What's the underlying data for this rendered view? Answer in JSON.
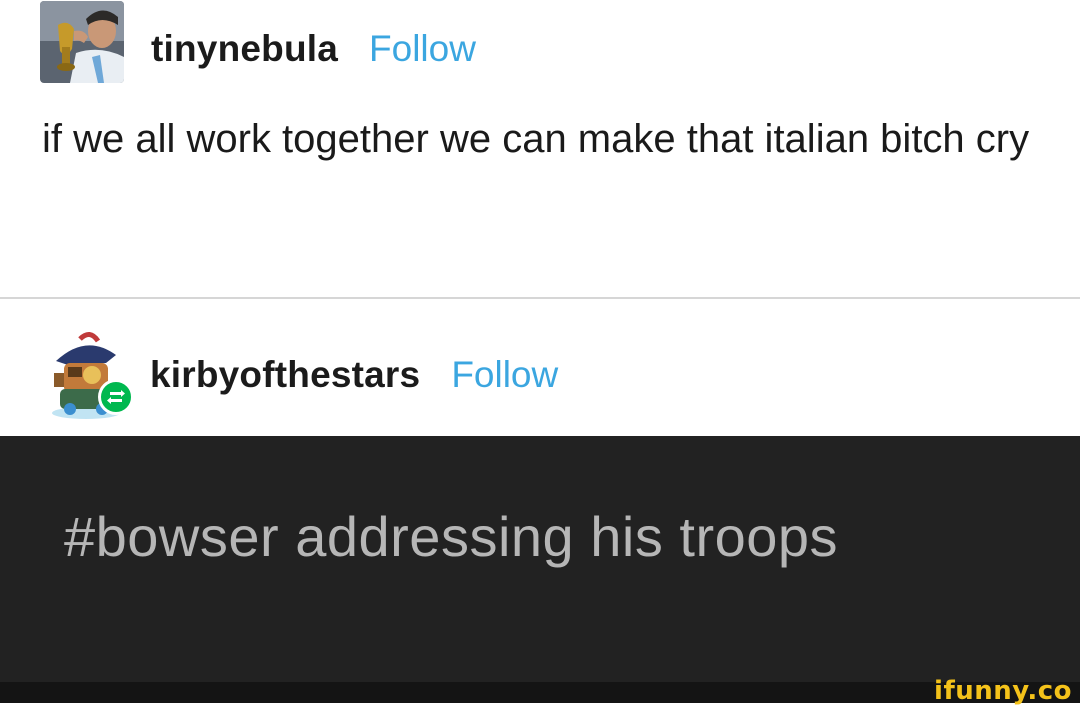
{
  "posts": [
    {
      "username": "tinynebula",
      "follow_label": "Follow",
      "text": "if we all work together we can make that italian bitch cry"
    },
    {
      "username": "kirbyofthestars",
      "follow_label": "Follow",
      "reblog": true
    }
  ],
  "tag_block": {
    "text": "#bowser addressing his troops"
  },
  "watermark": "ifunny.co",
  "colors": {
    "follow": "#3ba6e0",
    "reblog_badge": "#00b84f",
    "dark_block": "#222222",
    "watermark": "#f4c21a"
  }
}
